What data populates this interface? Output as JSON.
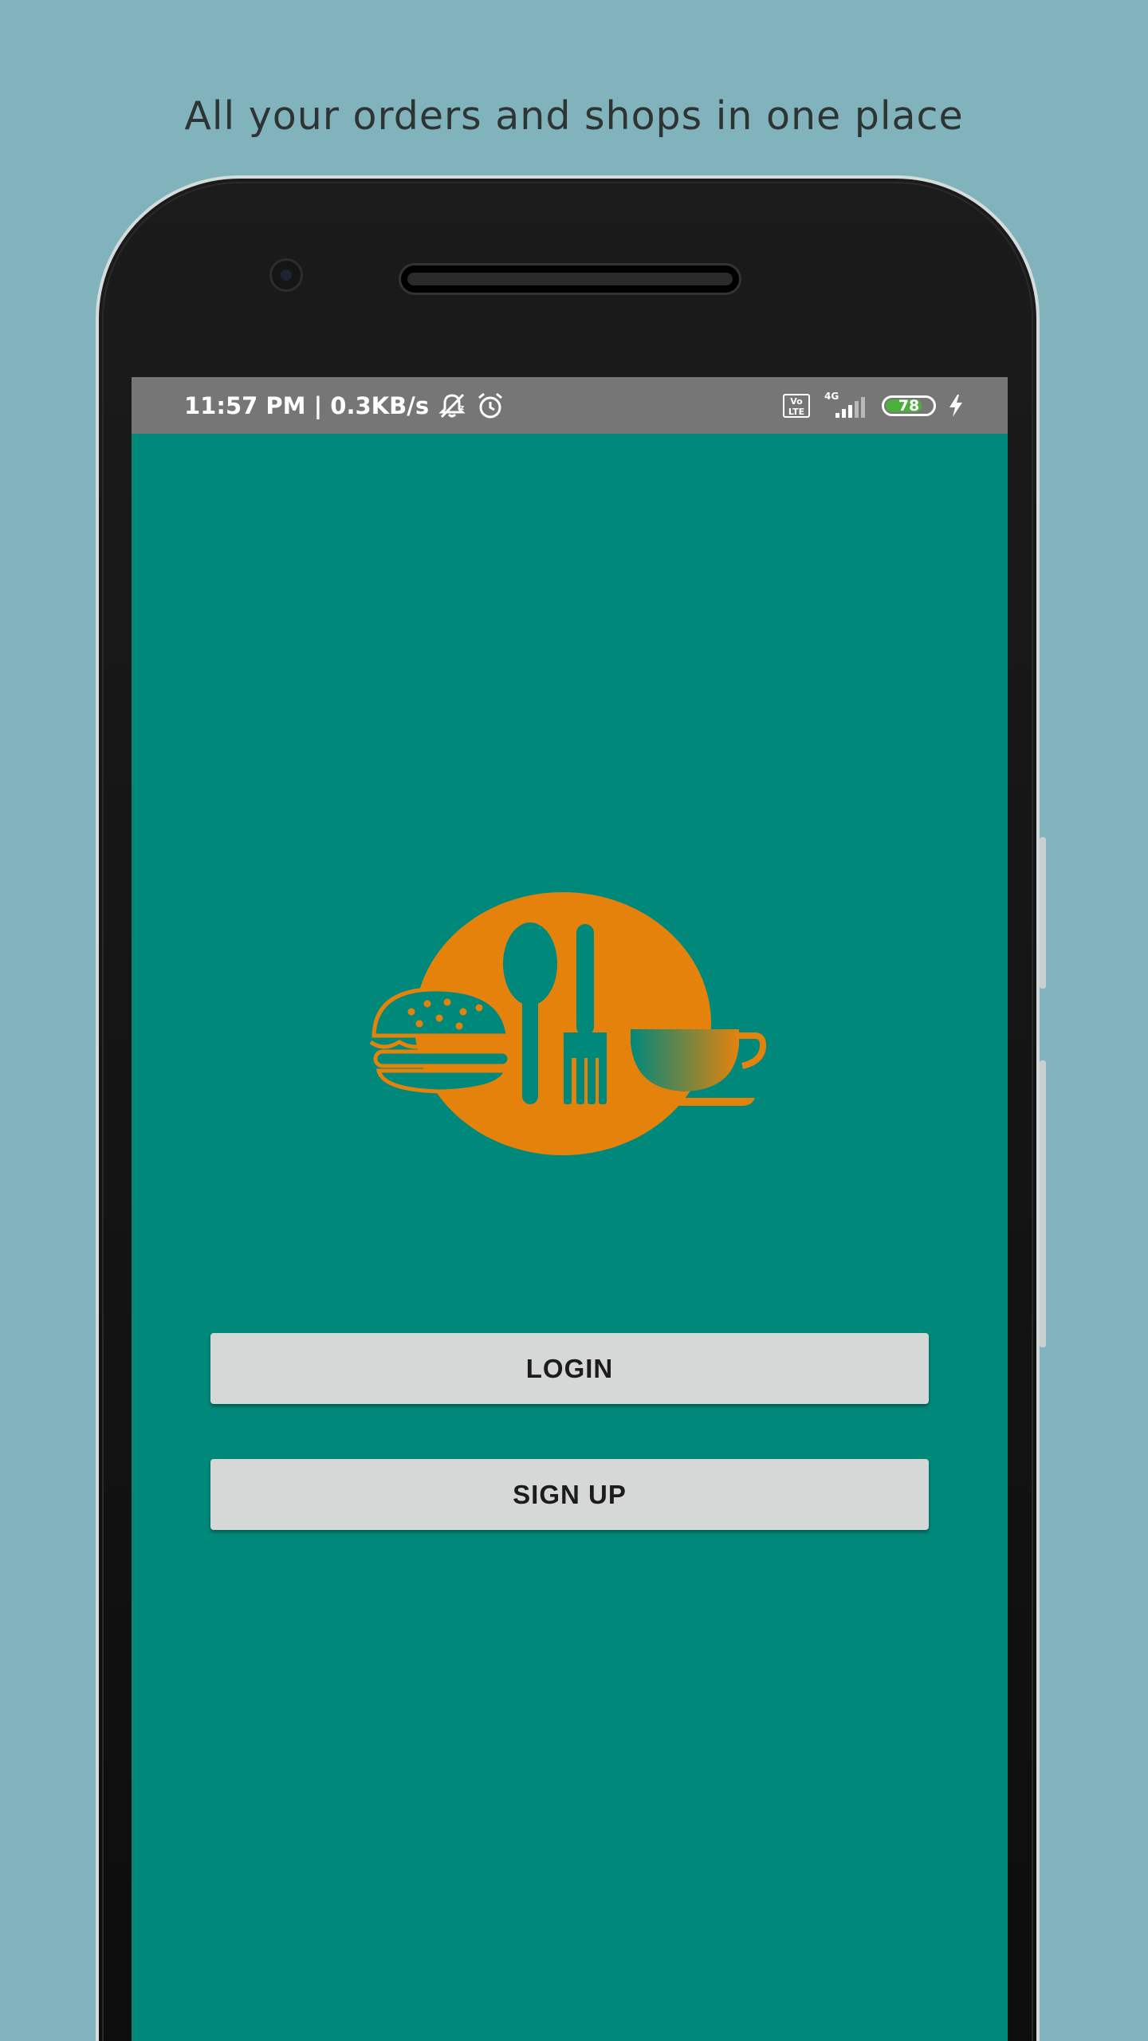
{
  "headline": "All your orders and shops in one place",
  "status_bar": {
    "time_and_speed": "11:57 PM | 0.3KB/s",
    "volte_label_top": "Vo",
    "volte_label_bottom": "LTE",
    "network_type": "4G",
    "battery_level": "78",
    "battery_fraction": 0.78,
    "icons": [
      "mute-icon",
      "alarm-icon",
      "volte-icon",
      "signal-icon",
      "battery-icon",
      "charging-icon"
    ]
  },
  "app": {
    "logo_icons": [
      "burger-icon",
      "spoon-icon",
      "fork-icon",
      "coffee-cup-icon"
    ],
    "login_label": "LOGIN",
    "signup_label": "SIGN UP"
  },
  "colors": {
    "page_background": "#80b3bb",
    "screen_background": "#00897b",
    "logo_orange": "#e5820c",
    "status_bar": "#767676",
    "button": "#d6d7d7"
  }
}
